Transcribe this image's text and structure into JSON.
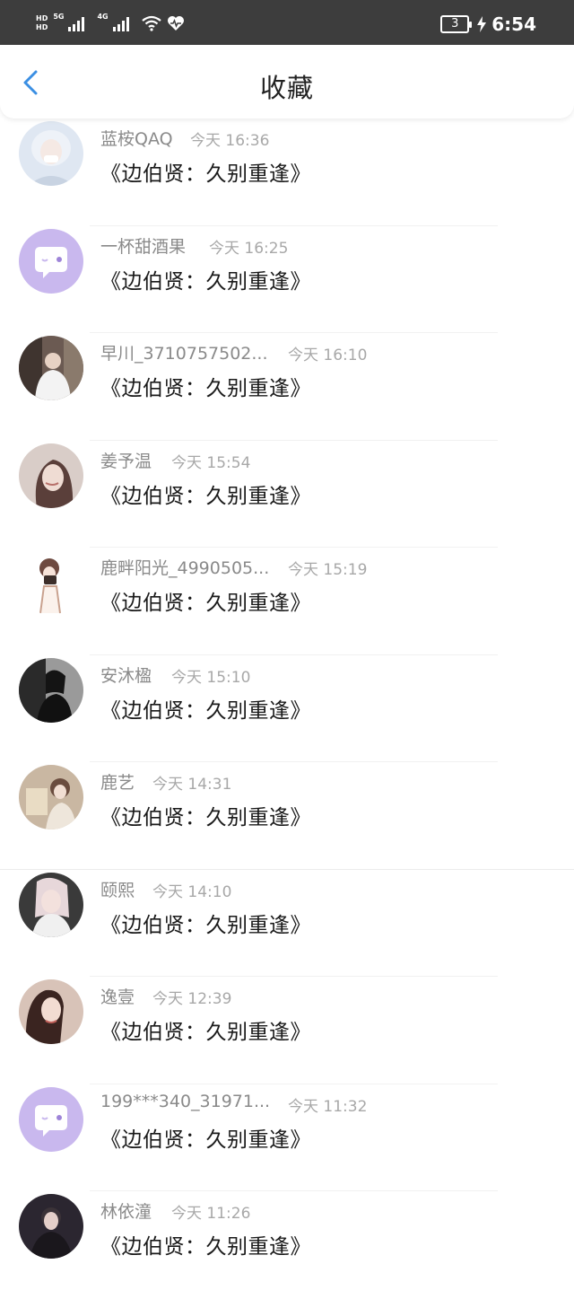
{
  "status_bar": {
    "hd1": "HD",
    "hd2": "HD",
    "net1": "5G",
    "net2": "4G",
    "battery": "3",
    "time": "6:54"
  },
  "header": {
    "title": "收藏",
    "back_icon": "chevron-left-icon"
  },
  "favorites": [
    {
      "user": "蓝桉QAQ",
      "time": "今天 16:36",
      "content": "《边伯贤：久别重逢》",
      "avatar": "photo"
    },
    {
      "user": "一杯甜酒果",
      "time": "今天 16:25",
      "content": "《边伯贤：久别重逢》",
      "avatar": "default-chat-bubble"
    },
    {
      "user": "早川_3710757502...",
      "time": "今天 16:10",
      "content": "《边伯贤：久别重逢》",
      "avatar": "photo"
    },
    {
      "user": "姜予温",
      "time": "今天 15:54",
      "content": "《边伯贤：久别重逢》",
      "avatar": "photo"
    },
    {
      "user": "鹿畔阳光_4990505...",
      "time": "今天 15:19",
      "content": "《边伯贤：久别重逢》",
      "avatar": "illustration"
    },
    {
      "user": "安沐楹",
      "time": "今天 15:10",
      "content": "《边伯贤：久别重逢》",
      "avatar": "photo"
    },
    {
      "user": "鹿艺",
      "time": "今天 14:31",
      "content": "《边伯贤：久别重逢》",
      "avatar": "photo"
    },
    {
      "user": "颐熙",
      "time": "今天 14:10",
      "content": "《边伯贤：久别重逢》",
      "avatar": "photo"
    },
    {
      "user": "逸壹",
      "time": "今天 12:39",
      "content": "《边伯贤：久别重逢》",
      "avatar": "photo"
    },
    {
      "user": "199***340_31971...",
      "time": "今天 11:32",
      "content": "《边伯贤：久别重逢》",
      "avatar": "default-chat-bubble"
    },
    {
      "user": "林依潼",
      "time": "今天 11:26",
      "content": "《边伯贤：久别重逢》",
      "avatar": "photo"
    }
  ],
  "colors": {
    "status_bar_bg": "#3d3d3d",
    "accent_back": "#3b8fe3",
    "default_avatar_bg": "#c9b8ee",
    "username": "#8a8a8a",
    "time": "#a8a8a8",
    "content": "#1a1a1a"
  }
}
